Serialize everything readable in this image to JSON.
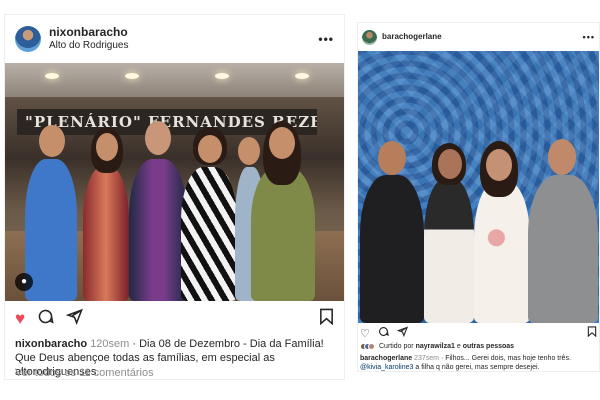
{
  "left_post": {
    "username": "nixonbaracho",
    "location": "Alto do Rodrigues",
    "photo_banner": "\"PLENÁRIO\" FERNANDES BEZERRA",
    "time_ago": "120sem",
    "caption": "· Dia 08 de Dezembro - Dia da Família! Que Deus abençoe todas as famílias, em especial as altorodriguenses.",
    "comments_link": "Ver todos os 11 comentários",
    "icons": [
      "more-icon",
      "user-tag-icon",
      "heart-filled-icon",
      "comment-icon",
      "share-icon",
      "save-icon"
    ],
    "accent_color": "#ed4956"
  },
  "right_post": {
    "username": "barachogerlane",
    "liked_prefix": "Curtido por",
    "liked_user": "nayrawilza1",
    "liked_and": "e",
    "liked_others": "outras pessoas",
    "caption_username": "barachogerlane",
    "time_ago": "237sem",
    "caption": "· Filhos... Gerei dois, mas hoje tenho três.",
    "comment_user": "@kivia_karoline3",
    "comment_text": "a filha q não gerei, mas sempre desejei.",
    "icons": [
      "more-icon",
      "heart-outline-icon",
      "comment-icon",
      "share-icon",
      "save-icon"
    ]
  }
}
